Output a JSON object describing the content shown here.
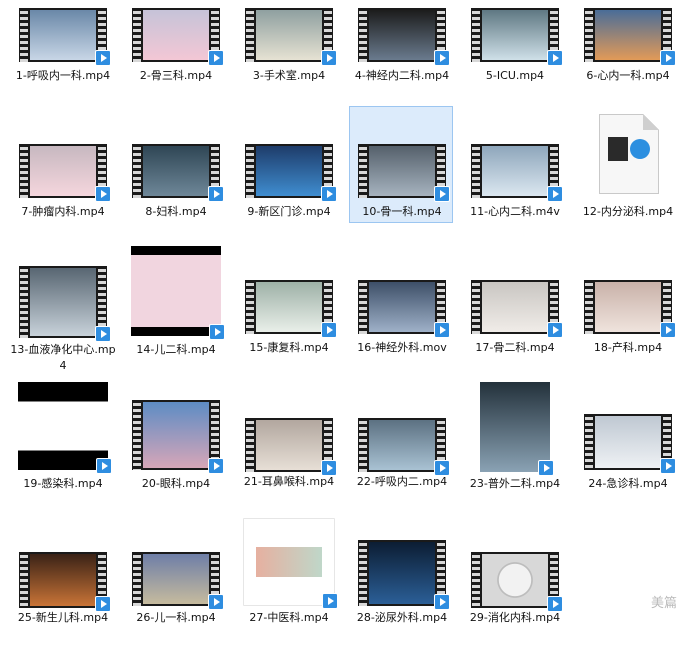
{
  "files": [
    {
      "name": "1-呼吸内一科.mp4",
      "c1": "#6a88a8",
      "c2": "#c8d6e6"
    },
    {
      "name": "2-骨三科.mp4",
      "c1": "#c6c3d8",
      "c2": "#f3c7d5"
    },
    {
      "name": "3-手术室.mp4",
      "c1": "#8fa0a0",
      "c2": "#e6e2d3"
    },
    {
      "name": "4-神经内二科.mp4",
      "c1": "#1c1c1c",
      "c2": "#6a7b8e"
    },
    {
      "name": "5-ICU.mp4",
      "c1": "#5f7883",
      "c2": "#cfe0e8"
    },
    {
      "name": "6-心内一科.mp4",
      "c1": "#4a6d98",
      "c2": "#e29a58"
    },
    {
      "name": "7-肿瘤内科.mp4",
      "c1": "#c7b8c0",
      "c2": "#f5d6dd"
    },
    {
      "name": "8-妇科.mp4",
      "c1": "#2f4655",
      "c2": "#6e8798"
    },
    {
      "name": "9-新区门诊.mp4",
      "c1": "#1e3c6a",
      "c2": "#3f8dd0"
    },
    {
      "name": "10-骨一科.mp4",
      "c1": "#55606b",
      "c2": "#a6b3bf"
    },
    {
      "name": "11-心内二科.m4v",
      "c1": "#8ea6bb",
      "c2": "#dbe7f0"
    },
    {
      "name": "12-内分泌科.mp4",
      "c1": "#f3f3f3",
      "c2": "#f3f3f3"
    },
    {
      "name": "13-血液净化中心.mp4",
      "c1": "#586672",
      "c2": "#c8d2da"
    },
    {
      "name": "14-儿二科.mp4",
      "c1": "#f1d5df",
      "c2": "#fff6f9"
    },
    {
      "name": "15-康复科.mp4",
      "c1": "#9eb1a7",
      "c2": "#e9efe9"
    },
    {
      "name": "16-神经外科.mov",
      "c1": "#3d4f68",
      "c2": "#9fb1c8"
    },
    {
      "name": "17-骨二科.mp4",
      "c1": "#c9c6c2",
      "c2": "#f0ece8"
    },
    {
      "name": "18-产科.mp4",
      "c1": "#c9b1a9",
      "c2": "#efe3dd"
    },
    {
      "name": "19-感染科.mp4",
      "c1": "#ffffff",
      "c2": "#ffffff"
    },
    {
      "name": "20-眼科.mp4",
      "c1": "#5d8cc4",
      "c2": "#d7a6b8"
    },
    {
      "name": "21-耳鼻喉科.mp4",
      "c1": "#b2a79f",
      "c2": "#e7dfd6"
    },
    {
      "name": "22-呼吸内二.mp4",
      "c1": "#5c7182",
      "c2": "#a9c2d3"
    },
    {
      "name": "23-普外二科.mp4",
      "c1": "#23313b",
      "c2": "#8aa2b4"
    },
    {
      "name": "24-急诊科.mp4",
      "c1": "#bfc8d2",
      "c2": "#eef1f4"
    },
    {
      "name": "25-新生儿科.mp4",
      "c1": "#3a2216",
      "c2": "#c97437"
    },
    {
      "name": "26-儿一科.mp4",
      "c1": "#6e7ea7",
      "c2": "#c6bb9e"
    },
    {
      "name": "27-中医科.mp4",
      "c1": "#ffffff",
      "c2": "#ffffff"
    },
    {
      "name": "28-泌尿外科.mp4",
      "c1": "#0c1d33",
      "c2": "#2b5f97"
    },
    {
      "name": "29-消化内科.mp4",
      "c1": "#d8d8d8",
      "c2": "#f0f0f0"
    }
  ],
  "watermark": "美篇"
}
